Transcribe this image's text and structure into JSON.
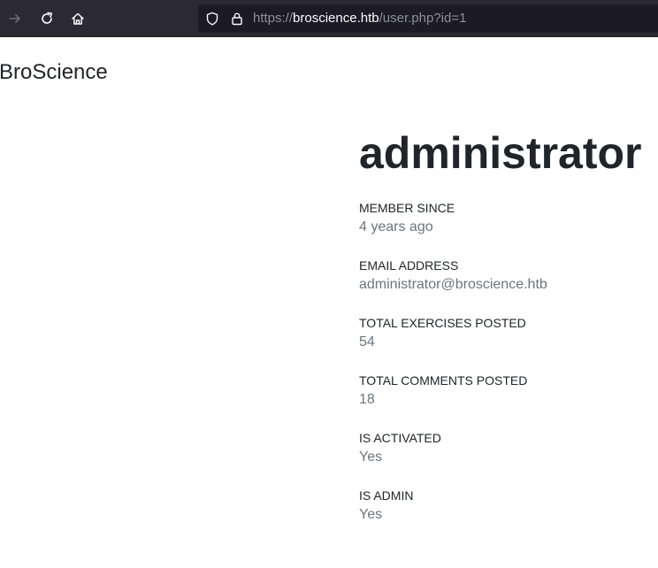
{
  "browser": {
    "url_prefix": "https://",
    "url_host": "broscience.htb",
    "url_path": "/user.php?id=1",
    "icons": {
      "forward": "arrow-right-icon",
      "reload": "reload-icon",
      "home": "home-icon",
      "shield": "shield-icon",
      "lock": "lock-icon"
    }
  },
  "site": {
    "brand": "BroScience"
  },
  "profile": {
    "username": "administrator",
    "fields": [
      {
        "label": "MEMBER SINCE",
        "value": "4 years ago"
      },
      {
        "label": "EMAIL ADDRESS",
        "value": "administrator@broscience.htb"
      },
      {
        "label": "TOTAL EXERCISES POSTED",
        "value": "54"
      },
      {
        "label": "TOTAL COMMENTS POSTED",
        "value": "18"
      },
      {
        "label": "IS ACTIVATED",
        "value": "Yes"
      },
      {
        "label": "IS ADMIN",
        "value": "Yes"
      }
    ]
  },
  "colors": {
    "toolbar_bg": "#2b2a33",
    "urlbar_bg": "#1c1b22",
    "text_primary": "#212529",
    "text_muted": "#6c757d"
  }
}
